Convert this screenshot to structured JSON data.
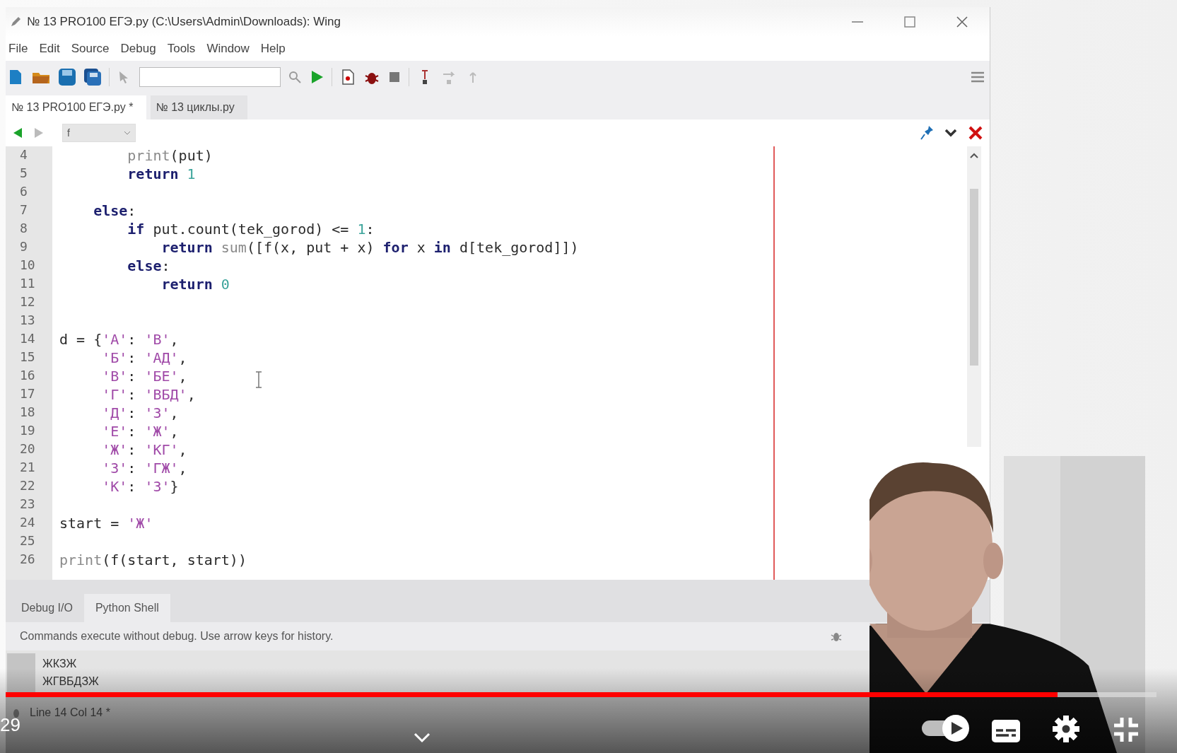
{
  "window": {
    "title": "№ 13 PRO100 ЕГЭ.py (C:\\Users\\Admin\\Downloads): Wing"
  },
  "menu": [
    "File",
    "Edit",
    "Source",
    "Debug",
    "Tools",
    "Window",
    "Help"
  ],
  "editor_tabs": [
    {
      "label": "№ 13 PRO100 ЕГЭ.py *",
      "selected": true
    },
    {
      "label": "№ 13 циклы.py",
      "selected": false
    }
  ],
  "scope_dropdown": {
    "value": "f"
  },
  "code_lines": [
    {
      "number": "4",
      "tokens": [
        {
          "text": "        print",
          "kind": "builtin"
        },
        {
          "text": "(put)",
          "kind": "plain"
        }
      ]
    },
    {
      "number": "5",
      "tokens": [
        {
          "text": "        return",
          "kind": "keyword"
        },
        {
          "text": " 1",
          "kind": "number"
        }
      ]
    },
    {
      "number": "6"
    },
    {
      "number": "7",
      "tokens": [
        {
          "text": "    else",
          "kind": "keyword"
        },
        {
          "text": ":",
          "kind": "plain"
        }
      ]
    },
    {
      "number": "8",
      "tokens": [
        {
          "text": "        if",
          "kind": "keyword"
        },
        {
          "text": " put.count(tek_gorod) <= ",
          "kind": "plain"
        },
        {
          "text": "1",
          "kind": "number"
        },
        {
          "text": ":",
          "kind": "plain"
        }
      ]
    },
    {
      "number": "9",
      "tokens": [
        {
          "text": "            return",
          "kind": "keyword"
        },
        {
          "text": " sum",
          "kind": "builtin"
        },
        {
          "text": "([f(x, put + x) ",
          "kind": "plain"
        },
        {
          "text": "for",
          "kind": "keyword"
        },
        {
          "text": " x ",
          "kind": "plain"
        },
        {
          "text": "in",
          "kind": "keyword"
        },
        {
          "text": " d[tek_gorod]])",
          "kind": "plain"
        }
      ]
    },
    {
      "number": "10",
      "tokens": [
        {
          "text": "        else",
          "kind": "keyword"
        },
        {
          "text": ":",
          "kind": "plain"
        }
      ]
    },
    {
      "number": "11",
      "tokens": [
        {
          "text": "            return",
          "kind": "keyword"
        },
        {
          "text": " 0",
          "kind": "number"
        }
      ]
    },
    {
      "number": "12"
    },
    {
      "number": "13"
    },
    {
      "number": "14",
      "tokens": [
        {
          "text": "d = {",
          "kind": "plain"
        },
        {
          "text": "'А'",
          "kind": "string"
        },
        {
          "text": ": ",
          "kind": "plain"
        },
        {
          "text": "'В'",
          "kind": "string"
        },
        {
          "text": ",",
          "kind": "plain"
        }
      ]
    },
    {
      "number": "15",
      "tokens": [
        {
          "text": "     'Б'",
          "kind": "string"
        },
        {
          "text": ": ",
          "kind": "plain"
        },
        {
          "text": "'АД'",
          "kind": "string"
        },
        {
          "text": ",",
          "kind": "plain"
        }
      ]
    },
    {
      "number": "16",
      "tokens": [
        {
          "text": "     'В'",
          "kind": "string"
        },
        {
          "text": ": ",
          "kind": "plain"
        },
        {
          "text": "'БЕ'",
          "kind": "string"
        },
        {
          "text": ",",
          "kind": "plain"
        }
      ]
    },
    {
      "number": "17",
      "tokens": [
        {
          "text": "     'Г'",
          "kind": "string"
        },
        {
          "text": ": ",
          "kind": "plain"
        },
        {
          "text": "'ВБД'",
          "kind": "string"
        },
        {
          "text": ",",
          "kind": "plain"
        }
      ]
    },
    {
      "number": "18",
      "tokens": [
        {
          "text": "     'Д'",
          "kind": "string"
        },
        {
          "text": ": ",
          "kind": "plain"
        },
        {
          "text": "'З'",
          "kind": "string"
        },
        {
          "text": ",",
          "kind": "plain"
        }
      ]
    },
    {
      "number": "19",
      "tokens": [
        {
          "text": "     'Е'",
          "kind": "string"
        },
        {
          "text": ": ",
          "kind": "plain"
        },
        {
          "text": "'Ж'",
          "kind": "string"
        },
        {
          "text": ",",
          "kind": "plain"
        }
      ]
    },
    {
      "number": "20",
      "tokens": [
        {
          "text": "     'Ж'",
          "kind": "string"
        },
        {
          "text": ": ",
          "kind": "plain"
        },
        {
          "text": "'КГ'",
          "kind": "string"
        },
        {
          "text": ",",
          "kind": "plain"
        }
      ]
    },
    {
      "number": "21",
      "tokens": [
        {
          "text": "     'З'",
          "kind": "string"
        },
        {
          "text": ": ",
          "kind": "plain"
        },
        {
          "text": "'ГЖ'",
          "kind": "string"
        },
        {
          "text": ",",
          "kind": "plain"
        }
      ]
    },
    {
      "number": "22",
      "tokens": [
        {
          "text": "     'К'",
          "kind": "string"
        },
        {
          "text": ": ",
          "kind": "plain"
        },
        {
          "text": "'З'",
          "kind": "string"
        },
        {
          "text": "}",
          "kind": "plain"
        }
      ]
    },
    {
      "number": "23"
    },
    {
      "number": "24",
      "tokens": [
        {
          "text": "start = ",
          "kind": "plain"
        },
        {
          "text": "'Ж'",
          "kind": "string"
        }
      ]
    },
    {
      "number": "25"
    },
    {
      "number": "26",
      "tokens": [
        {
          "text": "print",
          "kind": "builtin"
        },
        {
          "text": "(f(start, start))",
          "kind": "plain"
        }
      ]
    }
  ],
  "bottom_tabs": [
    {
      "label": "Debug I/O",
      "selected": false
    },
    {
      "label": "Python Shell",
      "selected": true
    }
  ],
  "shell": {
    "message": "Commands execute without debug.  Use arrow keys for history.",
    "output": [
      "ЖКЗЖ",
      "ЖГВБДЗЖ"
    ]
  },
  "status_bar": {
    "text": "Line 14 Col 14 *"
  },
  "player": {
    "time": "29",
    "progress": {
      "level": 0.914
    },
    "autoplay": {
      "on": true
    }
  }
}
